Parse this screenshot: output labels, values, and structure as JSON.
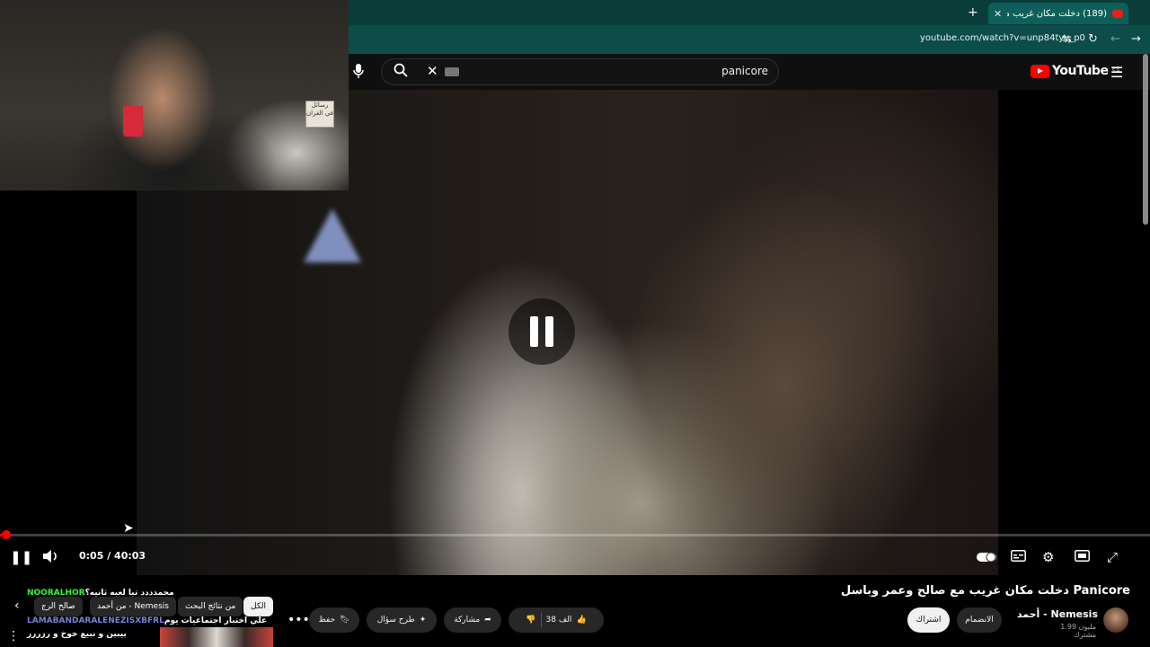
{
  "browser": {
    "tab_title": "(189) دخلت مكان غريب مع",
    "url": "youtube.com/watch?v=unp84tyy_p0"
  },
  "youtube": {
    "search_query": "panicore",
    "logo_text": "YouTube",
    "region": "SA"
  },
  "player": {
    "current_time": "0:05",
    "duration": "40:03",
    "time_display": "0:05 / 40:03",
    "progress_fraction": 0.002,
    "state": "paused"
  },
  "webcam": {
    "box_label": "رسائل في القران"
  },
  "video_info": {
    "title": "دخلت مكان غريب مع صالح وعمر وباسل Panicore",
    "channel": "أحمد - Nemesis",
    "subscribers": "1.99 مليون مشترك",
    "subscribe_label": "اشتراك",
    "join_label": "الانضمام",
    "likes": "38 الف",
    "share_label": "مشاركة",
    "ask_label": "طرح سؤال",
    "save_label": "حفظ"
  },
  "chips": {
    "all": "الكل",
    "search_results": "من نتائج البحث",
    "from_ahmed": "من أحمد - Nemesis",
    "saleh": "صالح الرج"
  },
  "chat": [
    {
      "user": "NOORALHOR",
      "message": "محمدددد تبا لعبه ثانيه؟"
    },
    {
      "user": "LAMABANDARALENEZISXBFRL",
      "message": "علي اختبار اجتماعيات يوم"
    },
    {
      "user": "",
      "message": "بيبين و نبيع خوخ و رزررر"
    }
  ],
  "colors": {
    "accent": "#ff0000",
    "tabbar": "#0a3d3a",
    "chat_user1": "#2eff2e",
    "chat_user2": "#7f7fd9"
  }
}
